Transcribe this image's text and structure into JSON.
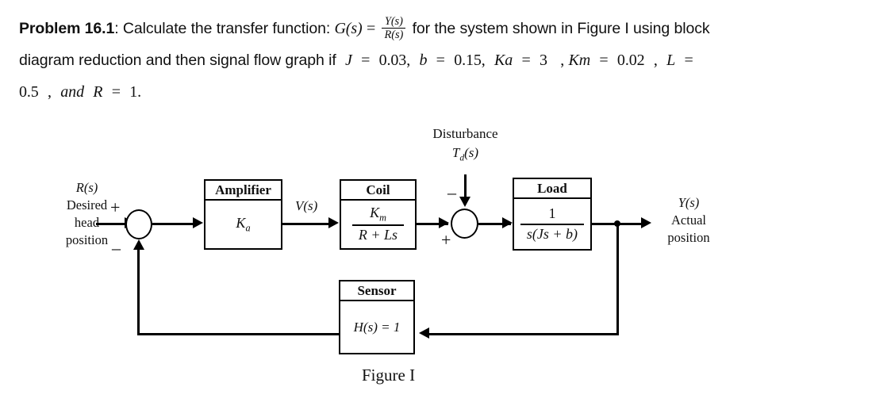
{
  "problem": {
    "label": "Problem 16.1",
    "colon": ":",
    "line1_a": "Calculate the transfer function:",
    "g_of_s": "G(s)",
    "equals": "=",
    "frac_num": "Y(s)",
    "frac_den": "R(s)",
    "line1_b": "for the system shown in Figure I using block",
    "line2_a": "diagram reduction and then signal flow graph if",
    "var_J": "J",
    "eq1": "=",
    "val_J": "0.03,",
    "var_b": "b",
    "eq2": "=",
    "val_b": "0.15,",
    "var_Ka": "Ka",
    "eq3": "=",
    "val_Ka": "3",
    "comma_Ka": ",",
    "var_Km": "Km",
    "eq4": "=",
    "val_Km": "0.02",
    "comma_Km": ",",
    "var_L": "L",
    "eq5": "=",
    "val_L": "0.5",
    "comma_L": ",",
    "and_word": "and",
    "var_R": "R",
    "eq6": "=",
    "val_R": "1."
  },
  "diagram": {
    "input_label": {
      "line1": "R(s)",
      "line2": "Desired",
      "line3": "head",
      "line4": "position"
    },
    "output_label": {
      "line1": "Y(s)",
      "line2": "Actual",
      "line3": "position"
    },
    "disturbance": {
      "title": "Disturbance",
      "signal": "T",
      "signal_sub": "d",
      "signal_tail": "(s)"
    },
    "sum1": {
      "plus": "+",
      "minus": "–"
    },
    "sum2": {
      "plus": "+",
      "minus": "–"
    },
    "amplifier": {
      "title": "Amplifier",
      "gain": "K",
      "gain_sub": "a"
    },
    "coil": {
      "title": "Coil",
      "num": "K",
      "num_sub": "m",
      "den": "R + Ls"
    },
    "load": {
      "title": "Load",
      "num": "1",
      "den": "s(Js + b)"
    },
    "sensor": {
      "title": "Sensor",
      "transfer": "H(s) = 1"
    },
    "v_signal": "V(s)",
    "caption": "Figure I"
  },
  "colors": {
    "ink": "#000000",
    "background": "#ffffff"
  }
}
